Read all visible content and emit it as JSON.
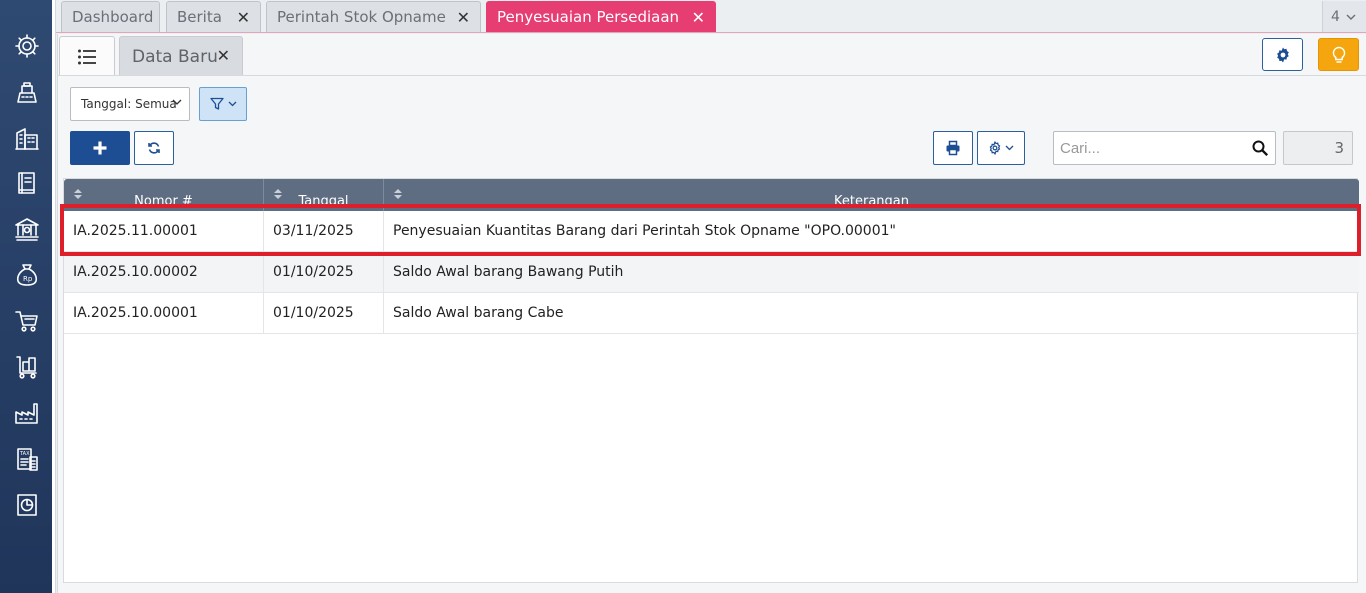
{
  "top_tabs": [
    {
      "label": "Dashboard",
      "closable": false,
      "active": false
    },
    {
      "label": "Berita",
      "closable": true,
      "active": false
    },
    {
      "label": "Perintah Stok Opname",
      "closable": true,
      "active": false
    },
    {
      "label": "Penyesuaian Persediaan",
      "closable": true,
      "active": true
    }
  ],
  "tab_count": "4",
  "close_glyph": "✕",
  "sub_tabs": {
    "list_icon": "list-icon",
    "data_baru": "Data Baru"
  },
  "filters": {
    "date_filter": "Tanggal: Semua"
  },
  "search": {
    "placeholder": "Cari..."
  },
  "record_count": "3",
  "table": {
    "columns": [
      "Nomor #",
      "Tanggal",
      "Keterangan"
    ],
    "rows": [
      [
        "IA.2025.11.00001",
        "03/11/2025",
        "Penyesuaian Kuantitas Barang dari Perintah Stok Opname \"OPO.00001\""
      ],
      [
        "IA.2025.10.00002",
        "01/10/2025",
        "Saldo Awal barang Bawang Putih"
      ],
      [
        "IA.2025.10.00001",
        "01/10/2025",
        "Saldo Awal barang Cabe"
      ]
    ],
    "highlighted_row": 0
  },
  "sidebar_icons": [
    "settings-icon",
    "cash-register-icon",
    "building-icon",
    "ledger-book-icon",
    "bank-icon",
    "money-bag-icon",
    "shopping-cart-icon",
    "inventory-cart-icon",
    "factory-icon",
    "tax-document-icon",
    "report-chart-icon"
  ],
  "colors": {
    "active_tab": "#e63d73",
    "primary": "#1d4e94",
    "bulb_button": "#f5a50d",
    "table_header": "#5f6d82",
    "highlight_border": "#dd1f2c",
    "sidebar": "#2f4a72"
  }
}
